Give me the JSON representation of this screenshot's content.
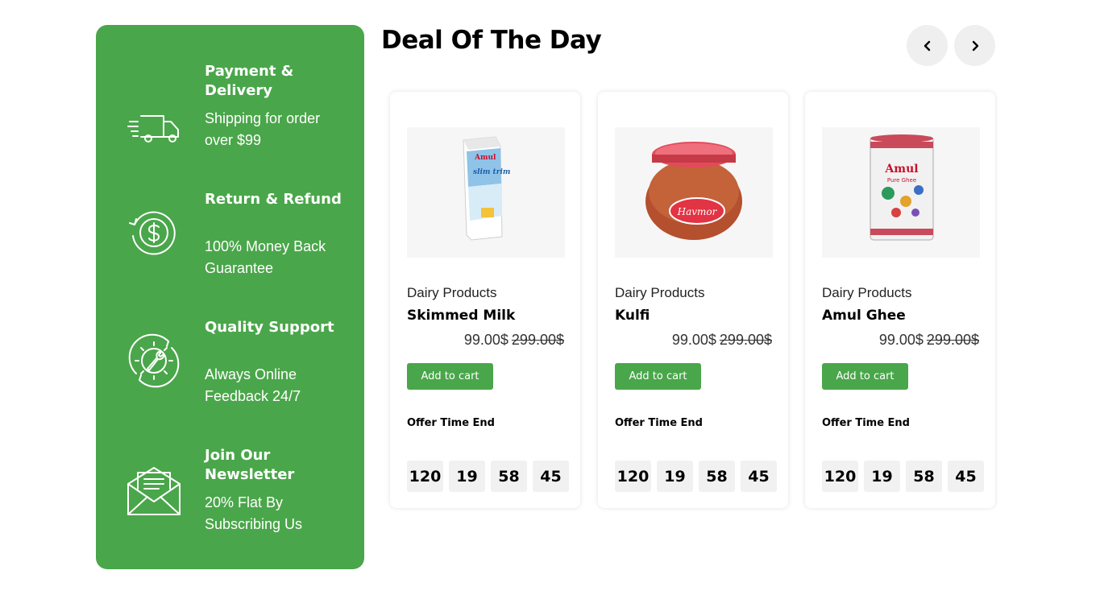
{
  "features": [
    {
      "title": "Payment & Delivery",
      "desc": "Shipping for order over $99",
      "icon": "delivery-truck-icon"
    },
    {
      "title": "Return & Refund",
      "desc": "100% Money Back Guarantee",
      "icon": "refund-dollar-icon"
    },
    {
      "title": "Quality Support",
      "desc": "Always Online Feedback 24/7",
      "icon": "support-gear-wrench-icon"
    },
    {
      "title": "Join Our Newsletter",
      "desc": "20% Flat By Subscribing Us",
      "icon": "newsletter-envelope-icon"
    }
  ],
  "deal": {
    "title": "Deal Of The Day",
    "prev_icon": "chevron-left-icon",
    "next_icon": "chevron-right-icon"
  },
  "products": [
    {
      "category": "Dairy Products",
      "name": "Skimmed Milk",
      "price": "99.00$",
      "old_price": "299.00$",
      "button": "Add to cart",
      "offer_label": "Offer Time End",
      "timer": [
        "120",
        "19",
        "58",
        "45"
      ],
      "image_brand": "Amul",
      "image_text": "slim trim"
    },
    {
      "category": "Dairy Products",
      "name": "Kulfi",
      "price": "99.00$",
      "old_price": "299.00$",
      "button": "Add to cart",
      "offer_label": "Offer Time End",
      "timer": [
        "120",
        "19",
        "58",
        "45"
      ],
      "image_brand": "Havmor"
    },
    {
      "category": "Dairy Products",
      "name": "Amul Ghee",
      "price": "99.00$",
      "old_price": "299.00$",
      "button": "Add to cart",
      "offer_label": "Offer Time End",
      "timer": [
        "120",
        "19",
        "58",
        "45"
      ],
      "image_brand": "Amul",
      "image_text": "Pure Ghee"
    }
  ],
  "colors": {
    "brand_green": "#4aa64a",
    "card_bg": "#ffffff",
    "timer_bg": "#f1f1f1"
  }
}
